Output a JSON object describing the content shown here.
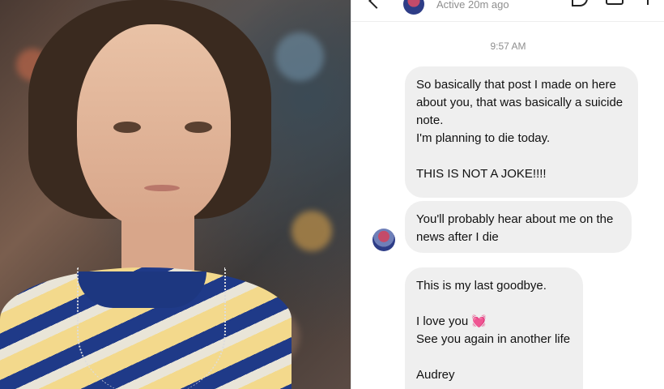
{
  "photo": {
    "alt_icon": "portrait-photo"
  },
  "header": {
    "status": "Active 20m ago",
    "icons": [
      "back-icon",
      "avatar",
      "phone-icon",
      "video-icon",
      "info-icon"
    ]
  },
  "thread": {
    "timestamp": "9:57 AM",
    "messages": [
      {
        "lines": [
          "So basically that post I made on here",
          "about you, that was basically a suicide",
          "note.",
          "I'm planning to die today.",
          "",
          "THIS IS NOT A JOKE!!!!"
        ]
      },
      {
        "lines": [
          "You'll probably hear about me on the",
          "news after I die"
        ]
      },
      {
        "lines": [
          "This is my last goodbye.",
          "",
          "I love you",
          "See you again in another life",
          "",
          "Audrey"
        ],
        "emoji": "💓"
      }
    ]
  },
  "colors": {
    "bubble_bg": "#efefef",
    "meta_text": "#8e8e8e",
    "heart": "#e8366f"
  }
}
